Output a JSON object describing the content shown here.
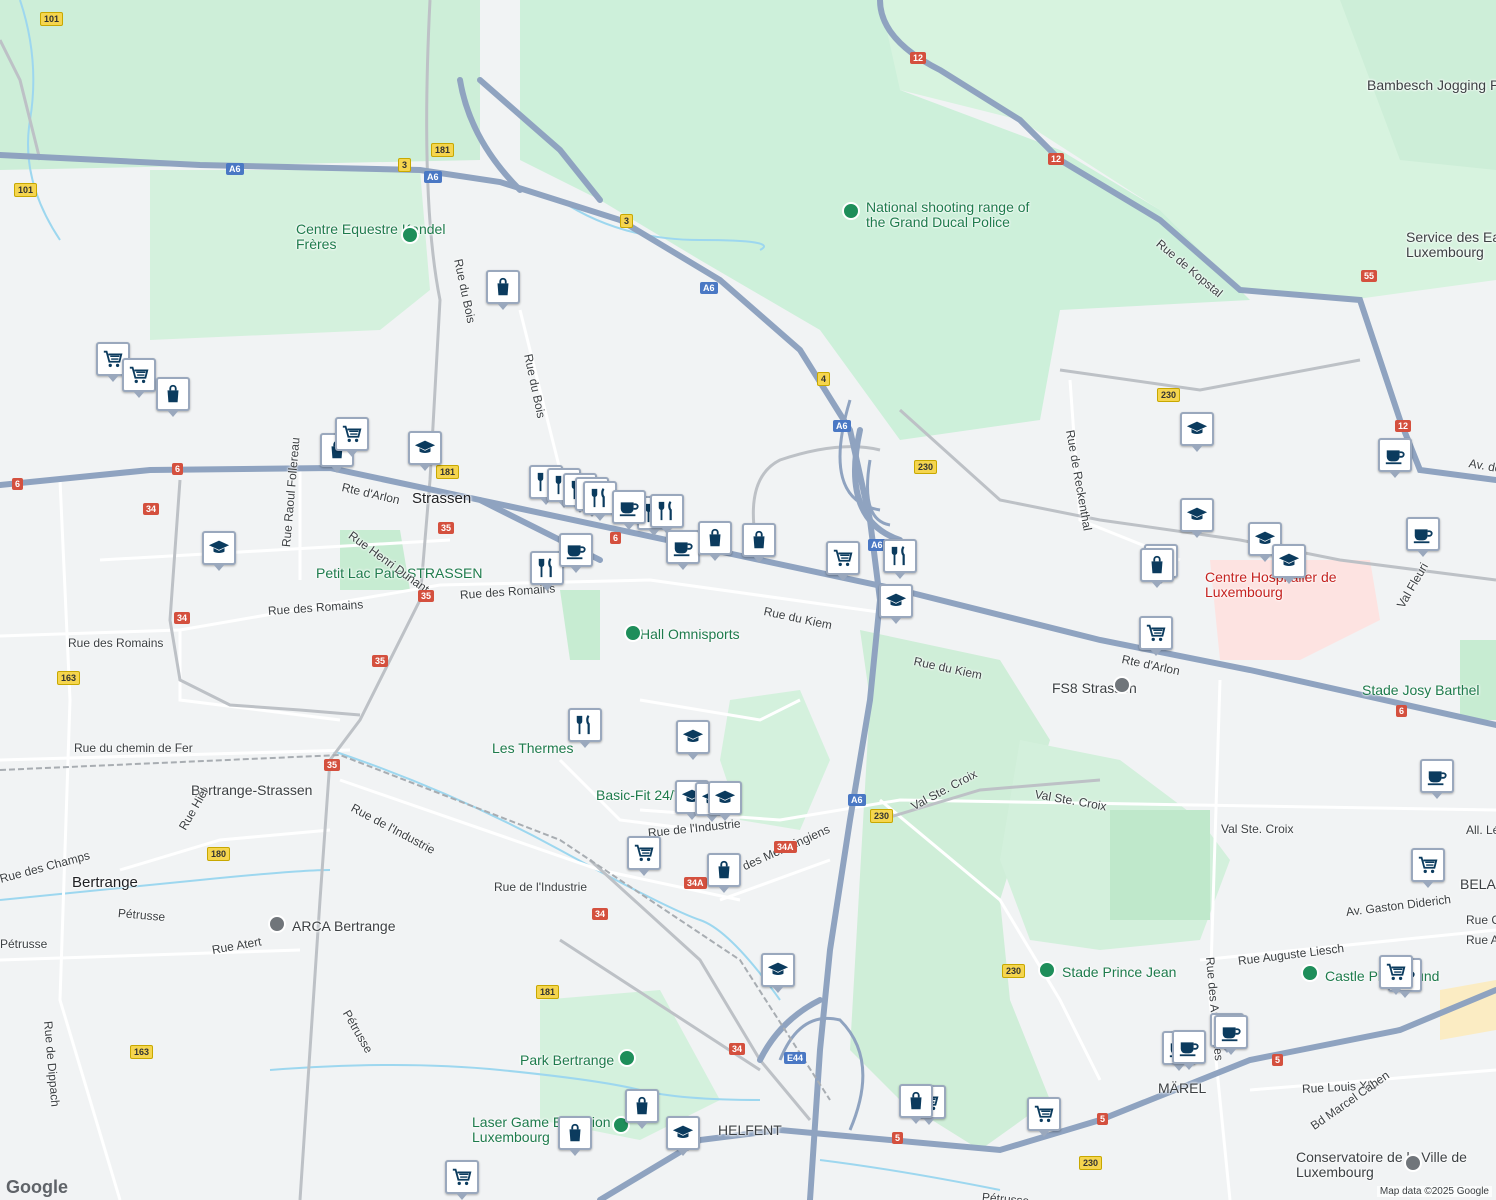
{
  "map": {
    "place_labels": [
      {
        "text": "Strassen",
        "cls": "big"
      },
      {
        "text": "Bertrange",
        "cls": "big"
      },
      {
        "text": "Centre Equestre Kandel Frères",
        "cls": "poi"
      },
      {
        "text": "National shooting range of the Grand Ducal Police",
        "cls": "poi"
      },
      {
        "text": "Bambesch Jogging Parcours",
        "cls": "gray"
      },
      {
        "text": "Service des Eaux Ville de Luxembourg",
        "cls": "gray"
      },
      {
        "text": "Petit Lac Parc STRASSEN",
        "cls": "poi"
      },
      {
        "text": "Hall Omnisports",
        "cls": "poi"
      },
      {
        "text": "Les Thermes",
        "cls": "poi"
      },
      {
        "text": "Basic-Fit 24/7",
        "cls": "poi"
      },
      {
        "text": "Bertrange-Strassen",
        "cls": "gray"
      },
      {
        "text": "ARCA Bertrange",
        "cls": "gray"
      },
      {
        "text": "FS8 Strassen",
        "cls": "gray"
      },
      {
        "text": "Centre Hospitalier de Luxembourg",
        "cls": "red"
      },
      {
        "text": "Stade Josy Barthel",
        "cls": "poi"
      },
      {
        "text": "Stade Prince Jean",
        "cls": "poi"
      },
      {
        "text": "Castle Playground",
        "cls": "poi"
      },
      {
        "text": "Park Bertrange",
        "cls": "poi"
      },
      {
        "text": "Laser Game Evolution Luxembourg",
        "cls": "poi"
      },
      {
        "text": "Conservatoire de la Ville de Luxembourg",
        "cls": "gray"
      },
      {
        "text": "MÄREL",
        "cls": "gray"
      },
      {
        "text": "BELAIR",
        "cls": "gray"
      },
      {
        "text": "HELFENT",
        "cls": "gray"
      }
    ],
    "street_labels": [
      "Rte d'Arlon",
      "Rue Henri Dunant",
      "Rue des Romains",
      "Rue des Romains",
      "Rue des Romains",
      "Rue du Kiem",
      "Rue du Kiem",
      "Rue du Bois",
      "Rue du Bois",
      "Rue Raoul Follereau",
      "Rue du chemin de Fer",
      "Rue de l'Industrie",
      "Rue de l'Industrie",
      "Rue de l'Industrie",
      "Rue des Mérovingiens",
      "Rue Hiel",
      "Rue des Champs",
      "Rue Atert",
      "Rue de Dippach",
      "Pétrusse",
      "Pétrusse",
      "Pétrusse",
      "Pétrusse",
      "Rue de Reckenthal",
      "Rue de Kopstal",
      "Val Ste. Croix",
      "Val Ste. Croix",
      "Val Ste. Croix",
      "Av. Gaston Diderich",
      "Rue Auguste Liesch",
      "Rue Louis XIV",
      "Bd Marcel Cahen",
      "Val Fleuri",
      "Rte d'Arlon",
      "Rue Charles",
      "Rue Arthur",
      "All. Léon",
      "Av. de",
      "Rue des Aubépines"
    ],
    "shields": [
      "A6",
      "A6",
      "A6",
      "A6",
      "A6",
      "A6",
      "12",
      "12",
      "12",
      "181",
      "181",
      "3",
      "3",
      "4",
      "101",
      "101",
      "6",
      "6",
      "6",
      "6",
      "34",
      "34",
      "34",
      "34",
      "34A",
      "34A",
      "35",
      "35",
      "35",
      "35",
      "163",
      "163",
      "180",
      "230",
      "230",
      "230",
      "230",
      "230",
      "55",
      "5",
      "5",
      "5",
      "E44",
      "181"
    ],
    "pins": [
      "shop",
      "shop",
      "cart",
      "cart",
      "shop",
      "cart",
      "school",
      "school",
      "restaurant",
      "restaurant",
      "restaurant",
      "restaurant",
      "restaurant",
      "restaurant",
      "cafe",
      "restaurant",
      "restaurant",
      "cafe",
      "cafe",
      "shop",
      "shop",
      "cart",
      "restaurant",
      "school",
      "restaurant",
      "school",
      "school",
      "school",
      "school",
      "cart",
      "shop",
      "school",
      "school",
      "cart",
      "shop",
      "cart",
      "shop",
      "cart",
      "school",
      "shop",
      "school",
      "cart",
      "school",
      "school",
      "shop",
      "cafe",
      "cafe",
      "cafe",
      "cafe",
      "cafe",
      "cafe",
      "cart",
      "cart",
      "cafe",
      "cafe",
      "shop"
    ],
    "attribution": "Map data ©2025 Google",
    "logo": "Google"
  }
}
